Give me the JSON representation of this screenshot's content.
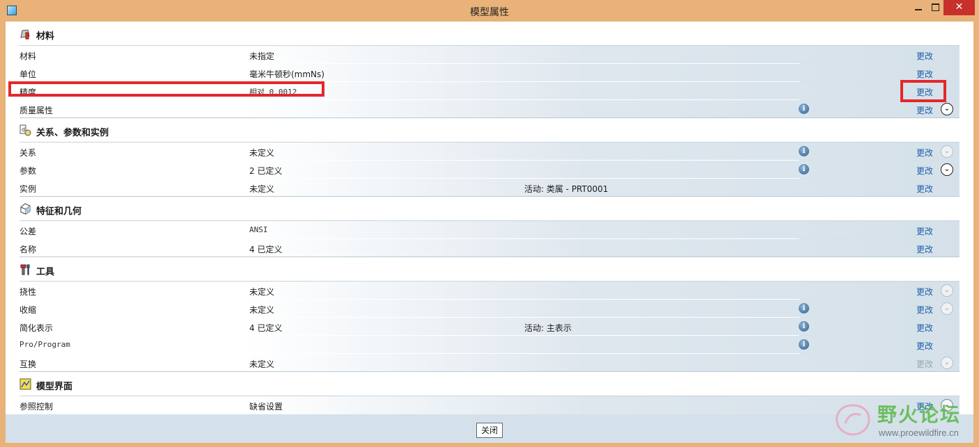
{
  "window": {
    "title": "模型属性",
    "close_glyph": "✕"
  },
  "sections": {
    "materials": {
      "title": "材料",
      "rows": [
        {
          "label": "材料",
          "value": "未指定",
          "change": "更改"
        },
        {
          "label": "单位",
          "value": "毫米牛顿秒(mmNs)",
          "change": "更改"
        },
        {
          "label": "精度",
          "value": "相对 0.0012",
          "change": "更改"
        },
        {
          "label": "质量属性",
          "value": "",
          "change": "更改",
          "info": "i",
          "chevron": "⌄"
        }
      ]
    },
    "relations": {
      "title": "关系、参数和实例",
      "rows": [
        {
          "label": "关系",
          "value": "未定义",
          "change": "更改",
          "info": "i",
          "chevron": "⌄"
        },
        {
          "label": "参数",
          "value": "2 已定义",
          "change": "更改",
          "info": "i",
          "chevron": "⌄"
        },
        {
          "label": "实例",
          "value": "未定义",
          "extra": "活动: 类属 - PRT0001",
          "change": "更改"
        }
      ]
    },
    "features": {
      "title": "特征和几何",
      "rows": [
        {
          "label": "公差",
          "value": "ANSI",
          "change": "更改"
        },
        {
          "label": "名称",
          "value": "4 已定义",
          "change": "更改"
        }
      ]
    },
    "tools": {
      "title": "工具",
      "rows": [
        {
          "label": "挠性",
          "value": "未定义",
          "change": "更改",
          "chevron": "⌄"
        },
        {
          "label": "收缩",
          "value": "未定义",
          "change": "更改",
          "info": "i",
          "chevron": "⌄"
        },
        {
          "label": "简化表示",
          "value": "4 已定义",
          "extra": "活动: 主表示",
          "change": "更改",
          "info": "i"
        },
        {
          "label": "Pro/Program",
          "value": "",
          "change": "更改",
          "info": "i"
        },
        {
          "label": "互换",
          "value": "未定义",
          "change": "更改",
          "chevron": "⌄"
        }
      ]
    },
    "interface": {
      "title": "模型界面",
      "rows": [
        {
          "label": "参照控制",
          "value": "缺省设置",
          "change": "更改",
          "chevron": "⌄"
        }
      ]
    }
  },
  "footer": {
    "close_label": "关闭"
  },
  "watermark": {
    "title": "野火论坛",
    "url": "www.proewildfire.cn"
  },
  "colors": {
    "accent_link": "#1f5fa8",
    "highlight": "#e5272b",
    "title_bar": "#e8b278",
    "row_tint": "#d5e1ea"
  }
}
